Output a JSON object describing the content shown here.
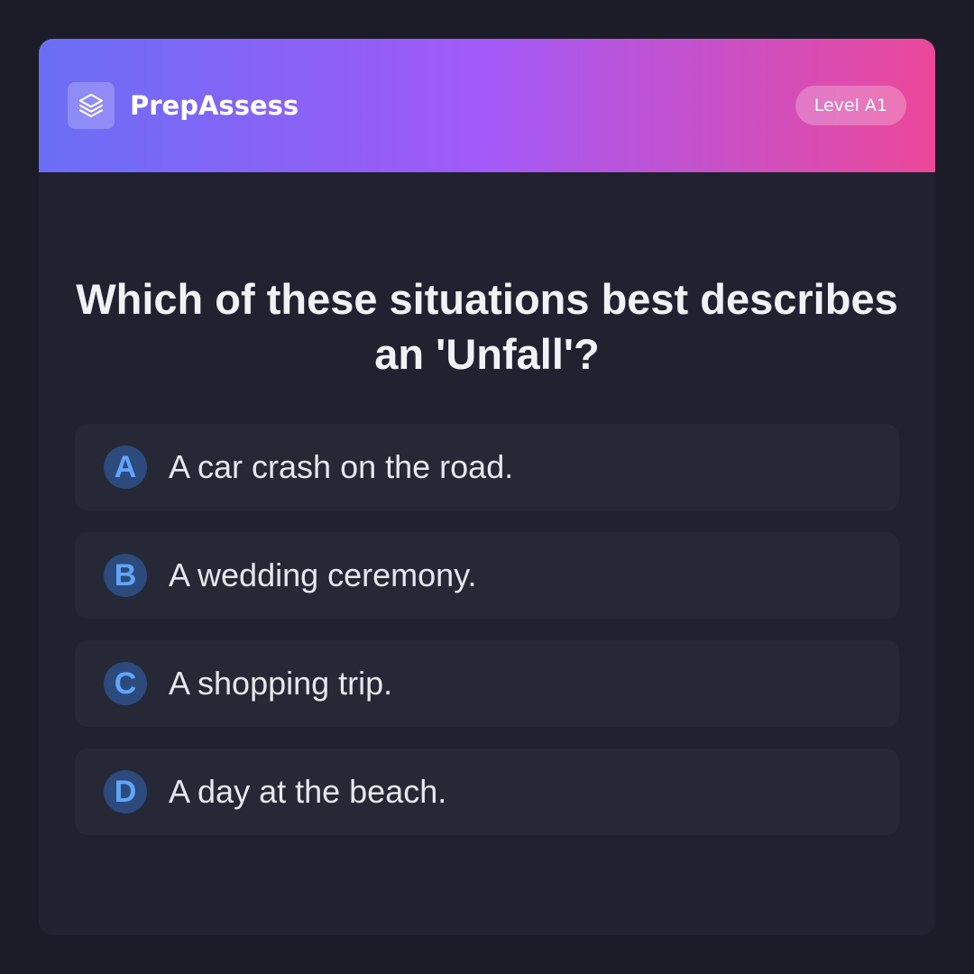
{
  "header": {
    "brand": "PrepAssess",
    "logo_icon": "layers-icon",
    "level": "Level A1",
    "gradient": [
      "#6a6ef5",
      "#a259f7",
      "#ec4899"
    ]
  },
  "question": {
    "text": "Which of these situations best describes an 'Unfall'?"
  },
  "options": [
    {
      "letter": "A",
      "text": "A car crash on the road."
    },
    {
      "letter": "B",
      "text": "A wedding ceremony."
    },
    {
      "letter": "C",
      "text": "A shopping trip."
    },
    {
      "letter": "D",
      "text": "A day at the beach."
    }
  ],
  "colors": {
    "background": "#1b1c27",
    "card": "#20222f",
    "option_bg": "#262836",
    "letter_bg": "#2c4a7c",
    "letter_fg": "#60a5fa"
  }
}
